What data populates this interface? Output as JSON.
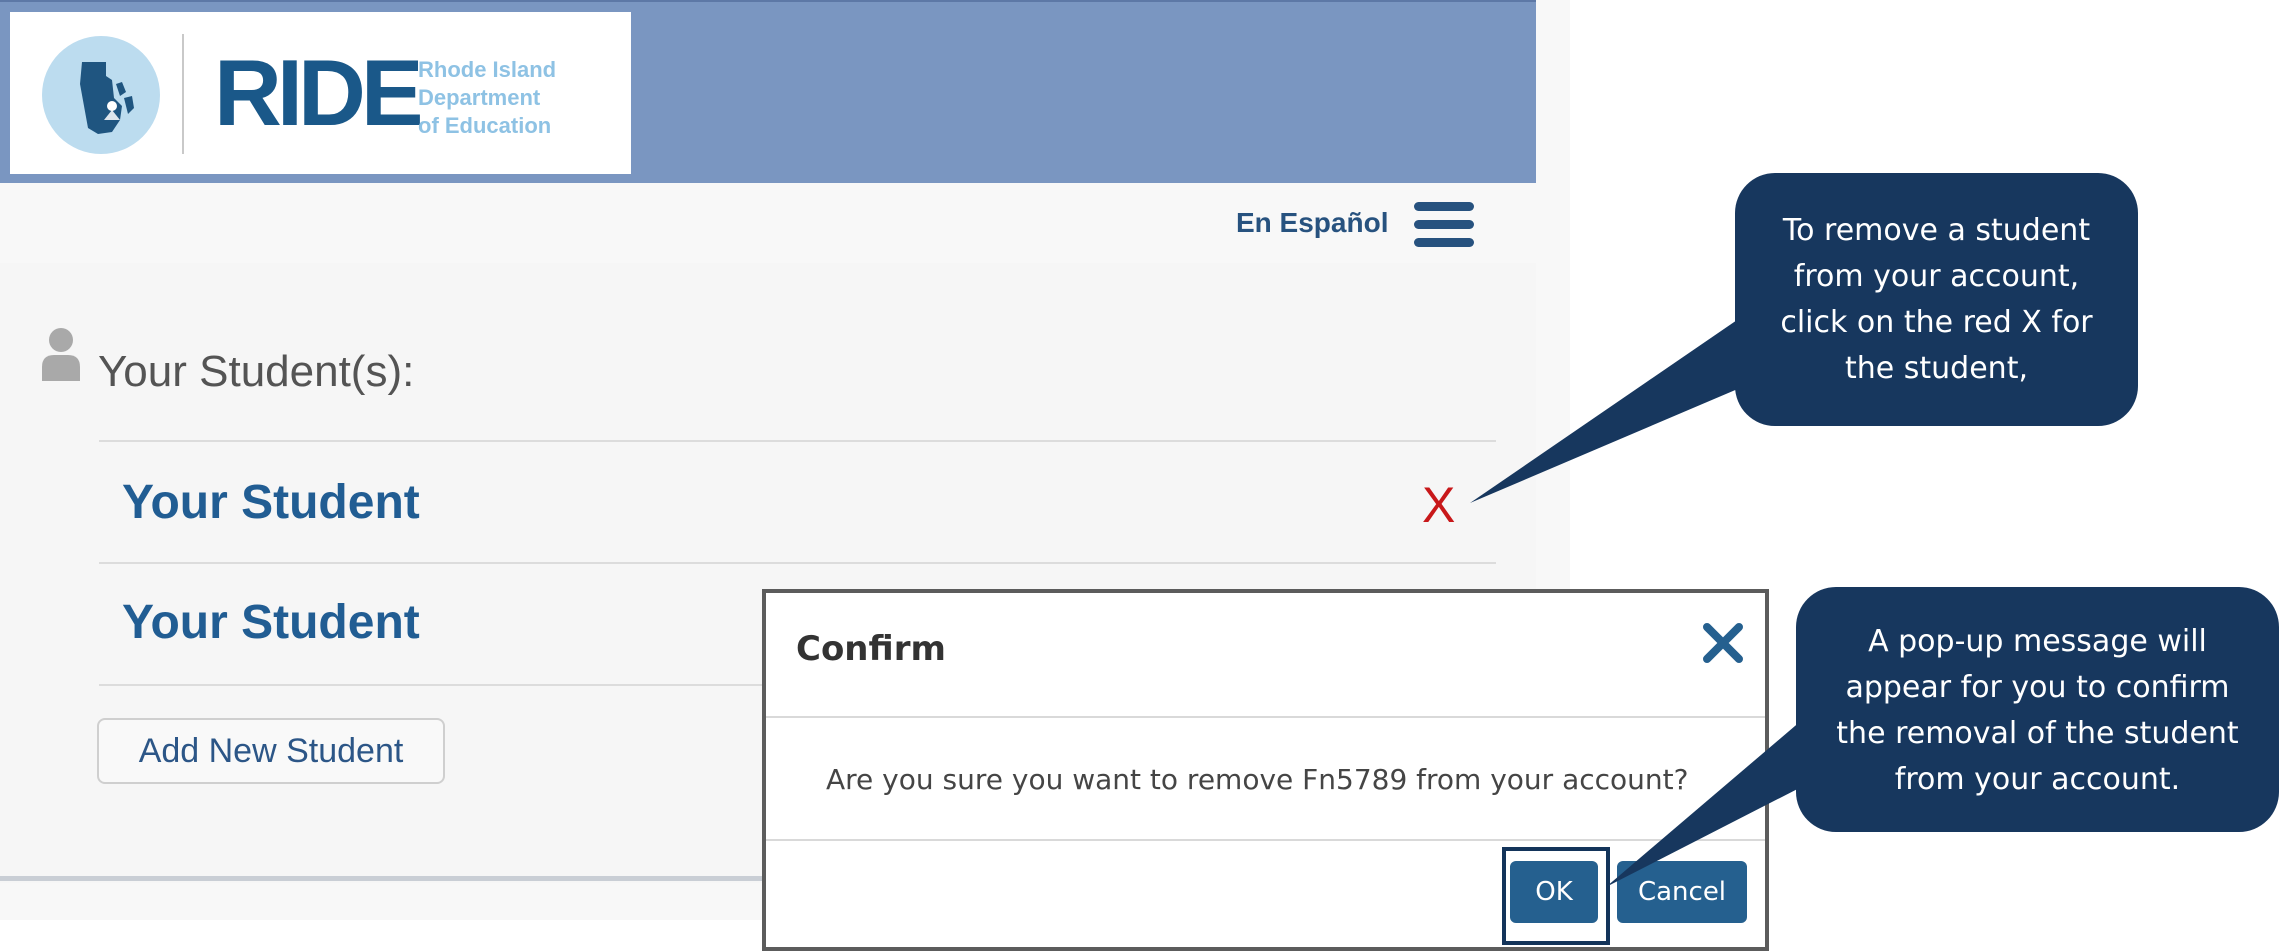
{
  "header": {
    "logo_wordmark": "RIDE",
    "logo_subtitle_lines": [
      "Rhode Island",
      "Department",
      "of Education"
    ]
  },
  "topnav": {
    "language_link": "En Español",
    "menu_icon": "hamburger-menu-icon"
  },
  "students": {
    "section_title": "Your Student(s):",
    "section_icon": "person-icon",
    "items": [
      {
        "name": "Your Student",
        "remove_label": "X"
      },
      {
        "name": "Your Student"
      }
    ],
    "add_button": "Add New Student"
  },
  "modal": {
    "title": "Confirm",
    "close_icon": "close-icon",
    "message": "Are you sure you want to remove Fn5789 from your account?",
    "ok_label": "OK",
    "cancel_label": "Cancel"
  },
  "callouts": {
    "first_lines": [
      "To remove a student",
      "from your account,",
      "click on the red X for",
      "the student,"
    ],
    "second_lines": [
      "A pop-up message will",
      "appear for you to confirm",
      "the removal of the student",
      "from your account."
    ]
  },
  "colors": {
    "header_bg": "#7a96c1",
    "brand_blue": "#1a5889",
    "remove_red": "#c8181a",
    "button_blue": "#25608f",
    "callout_navy": "#17375e"
  }
}
